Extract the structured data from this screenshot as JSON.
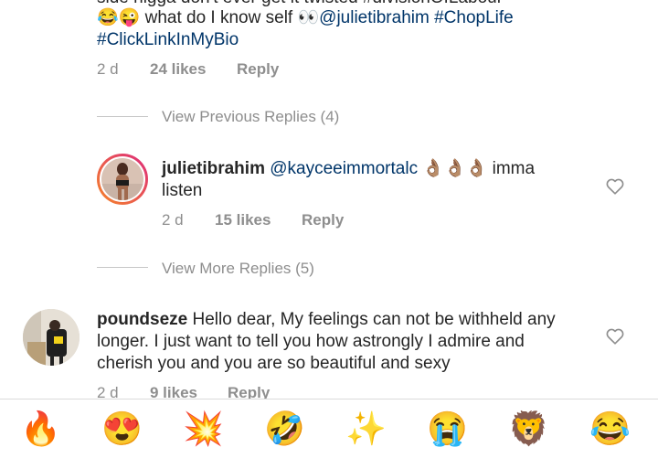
{
  "top_comment": {
    "partial_line": "side nigga don't ever get it twisted #divisionOfLabour",
    "line2_emojis": "😂😜",
    "line2_text": " what do I know self ",
    "eyes": "👀",
    "mention": "@julietibrahim",
    "hashtag1": " #ChopLife",
    "hashtag2": "#ClickLinkInMyBio",
    "time": "2 d",
    "likes": "24 likes",
    "reply": "Reply"
  },
  "view_previous": "View Previous Replies (4)",
  "reply_comment": {
    "username": "julietibrahim",
    "mention": "@kayceeimmortalc",
    "emojis": "👌🏽👌🏽👌🏽",
    "text_after": " imma",
    "text_line2": "listen",
    "time": "2 d",
    "likes": "15 likes",
    "reply": "Reply"
  },
  "view_more": "View More Replies (5)",
  "bottom_comment": {
    "username": "poundseze",
    "text1": " Hello dear,  My feelings can not be withheld any",
    "text2": "longer. I just want to  tell you how astrongly  I admire and",
    "text3": "cherish you and you are so beautiful and sexy",
    "time": "2 d",
    "likes": "9 likes",
    "reply": "Reply"
  },
  "emoji_bar": [
    "🔥",
    "😍",
    "💥",
    "🤣",
    "✨",
    "😭",
    "🦁",
    "😂"
  ],
  "icons": {
    "heart": "heart-outline-icon",
    "avatar1": "julietibrahim-avatar",
    "avatar2": "poundseze-avatar"
  },
  "colors": {
    "link": "#003569",
    "meta": "#8e8e8e",
    "story_ring_start": "#f58529",
    "story_ring_end": "#dd2a7b"
  }
}
